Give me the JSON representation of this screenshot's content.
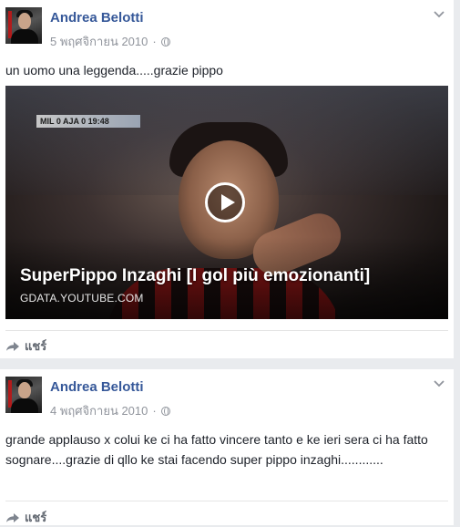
{
  "posts": [
    {
      "author": "Andrea Belotti",
      "date": "5 พฤศจิกายน 2010",
      "separator": "·",
      "text": "un uomo una leggenda.....grazie pippo",
      "video": {
        "title": "SuperPippo Inzaghi [I gol più emozionanti]",
        "source": "GDATA.YOUTUBE.COM",
        "score_overlay": "MIL 0 AJA 0 19:48"
      },
      "share_label": "แชร์"
    },
    {
      "author": "Andrea Belotti",
      "date": "4 พฤศจิกายน 2010",
      "separator": "·",
      "text": "grande applauso x colui ke ci ha fatto vincere tanto e ke ieri sera ci ha fatto sognare....grazie di qllo ke stai facendo super pippo inzaghi............",
      "share_label": "แชร์"
    }
  ],
  "icons": {
    "privacy": "globe-icon",
    "options": "chevron-down-icon",
    "share": "share-arrow-icon",
    "play": "play-icon"
  },
  "colors": {
    "author_link": "#365899",
    "meta_text": "#90949c",
    "background": "#e9ebee"
  }
}
